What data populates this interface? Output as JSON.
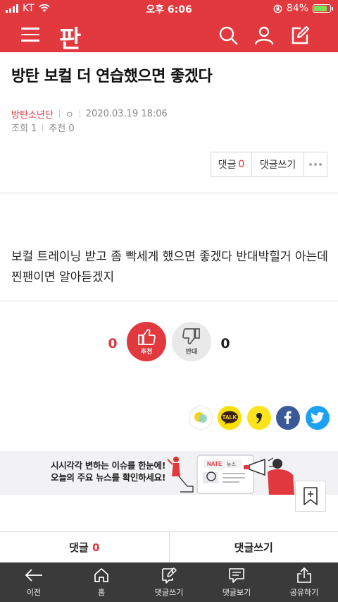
{
  "status_bar": {
    "carrier": "KT",
    "time": "오후 6:06",
    "battery": "84%",
    "battery_level": 0.84
  },
  "header": {
    "logo": "판",
    "icons": [
      "menu-icon",
      "search-icon",
      "user-icon",
      "edit-icon"
    ]
  },
  "post": {
    "title": "방탄 보컬 더 연습했으면 좋겠다",
    "category": "방탄소년단",
    "author_mark": "ㅇ",
    "date": "2020.03.19 18:06",
    "views": "조회 1",
    "recommends": "추천 0",
    "body": "보컬 트레이닝 받고 좀 빡세게 했으면 좋겠다 반대박힐거 아는데 찐팬이면 알아듣겠지"
  },
  "actions": {
    "comment_label": "댓글",
    "comment_count": "0",
    "write_comment": "댓글쓰기"
  },
  "vote": {
    "up_count": "0",
    "up_label": "추천",
    "down_count": "0",
    "down_label": "반대"
  },
  "share": [
    "kakaostory-icon",
    "kakaotalk-icon",
    "comma-icon",
    "facebook-icon",
    "twitter-icon"
  ],
  "share_labels": {
    "kakaotalk": "TALK"
  },
  "banner": {
    "line1": "시시각각 변하는 이슈를 한눈에!",
    "line2": "오늘의 주요 뉴스를 확인하세요!",
    "brand": "NATE",
    "brand_suffix": "뉴스"
  },
  "comment_bar": {
    "comment_label": "댓글",
    "comment_count": "0",
    "write_label": "댓글쓰기"
  },
  "bottom_nav": [
    {
      "label": "이전",
      "icon": "arrow-left-icon"
    },
    {
      "label": "홈",
      "icon": "home-icon"
    },
    {
      "label": "댓글쓰기",
      "icon": "write-comment-icon"
    },
    {
      "label": "댓글보기",
      "icon": "view-comments-icon"
    },
    {
      "label": "공유하기",
      "icon": "share-icon"
    }
  ],
  "colors": {
    "brand_red": "#e2393f",
    "nav_dark": "#3a3a3a"
  }
}
